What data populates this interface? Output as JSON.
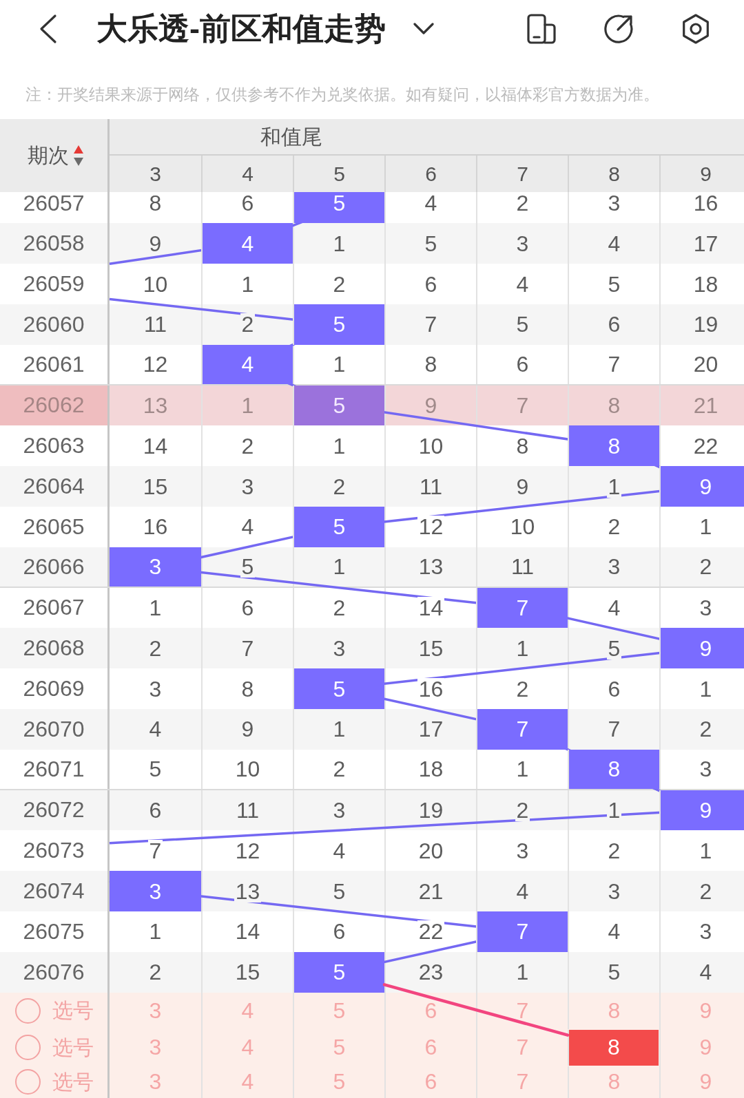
{
  "top_bar": {
    "title": "大乐透-前区和值走势"
  },
  "notice": "注：开奖结果来源于网络，仅供参考不作为兑奖依据。如有疑问，以福体彩官方数据为准。",
  "table": {
    "issue_heading": "期次",
    "sort_ascending": true,
    "group_heading": "和值尾",
    "columns": [
      "3",
      "4",
      "5",
      "6",
      "7",
      "8",
      "9"
    ],
    "rows": [
      {
        "issue": "26057",
        "selected": false,
        "cells": [
          {
            "text": "8",
            "hit": false
          },
          {
            "text": "6",
            "hit": false
          },
          {
            "text": "5",
            "hit": true
          },
          {
            "text": "4",
            "hit": false
          },
          {
            "text": "2",
            "hit": false
          },
          {
            "text": "3",
            "hit": false
          },
          {
            "text": "16",
            "hit": false
          }
        ]
      },
      {
        "issue": "26058",
        "selected": false,
        "cells": [
          {
            "text": "9",
            "hit": false
          },
          {
            "text": "4",
            "hit": true
          },
          {
            "text": "1",
            "hit": false
          },
          {
            "text": "5",
            "hit": false
          },
          {
            "text": "3",
            "hit": false
          },
          {
            "text": "4",
            "hit": false
          },
          {
            "text": "17",
            "hit": false
          }
        ]
      },
      {
        "issue": "26059",
        "selected": false,
        "cells": [
          {
            "text": "10",
            "hit": false
          },
          {
            "text": "1",
            "hit": false
          },
          {
            "text": "2",
            "hit": false
          },
          {
            "text": "6",
            "hit": false
          },
          {
            "text": "4",
            "hit": false
          },
          {
            "text": "5",
            "hit": false
          },
          {
            "text": "18",
            "hit": false
          }
        ]
      },
      {
        "issue": "26060",
        "selected": false,
        "cells": [
          {
            "text": "11",
            "hit": false
          },
          {
            "text": "2",
            "hit": false
          },
          {
            "text": "5",
            "hit": true
          },
          {
            "text": "7",
            "hit": false
          },
          {
            "text": "5",
            "hit": false
          },
          {
            "text": "6",
            "hit": false
          },
          {
            "text": "19",
            "hit": false
          }
        ]
      },
      {
        "issue": "26061",
        "selected": false,
        "cells": [
          {
            "text": "12",
            "hit": false
          },
          {
            "text": "4",
            "hit": true
          },
          {
            "text": "1",
            "hit": false
          },
          {
            "text": "8",
            "hit": false
          },
          {
            "text": "6",
            "hit": false
          },
          {
            "text": "7",
            "hit": false
          },
          {
            "text": "20",
            "hit": false
          }
        ]
      },
      {
        "issue": "26062",
        "selected": true,
        "cells": [
          {
            "text": "13",
            "hit": false
          },
          {
            "text": "1",
            "hit": false
          },
          {
            "text": "5",
            "hit": true
          },
          {
            "text": "9",
            "hit": false
          },
          {
            "text": "7",
            "hit": false
          },
          {
            "text": "8",
            "hit": false
          },
          {
            "text": "21",
            "hit": false
          }
        ]
      },
      {
        "issue": "26063",
        "selected": false,
        "cells": [
          {
            "text": "14",
            "hit": false
          },
          {
            "text": "2",
            "hit": false
          },
          {
            "text": "1",
            "hit": false
          },
          {
            "text": "10",
            "hit": false
          },
          {
            "text": "8",
            "hit": false
          },
          {
            "text": "8",
            "hit": true
          },
          {
            "text": "22",
            "hit": false
          }
        ]
      },
      {
        "issue": "26064",
        "selected": false,
        "cells": [
          {
            "text": "15",
            "hit": false
          },
          {
            "text": "3",
            "hit": false
          },
          {
            "text": "2",
            "hit": false
          },
          {
            "text": "11",
            "hit": false
          },
          {
            "text": "9",
            "hit": false
          },
          {
            "text": "1",
            "hit": false
          },
          {
            "text": "9",
            "hit": true
          }
        ]
      },
      {
        "issue": "26065",
        "selected": false,
        "cells": [
          {
            "text": "16",
            "hit": false
          },
          {
            "text": "4",
            "hit": false
          },
          {
            "text": "5",
            "hit": true
          },
          {
            "text": "12",
            "hit": false
          },
          {
            "text": "10",
            "hit": false
          },
          {
            "text": "2",
            "hit": false
          },
          {
            "text": "1",
            "hit": false
          }
        ]
      },
      {
        "issue": "26066",
        "selected": false,
        "cells": [
          {
            "text": "3",
            "hit": true
          },
          {
            "text": "5",
            "hit": false
          },
          {
            "text": "1",
            "hit": false
          },
          {
            "text": "13",
            "hit": false
          },
          {
            "text": "11",
            "hit": false
          },
          {
            "text": "3",
            "hit": false
          },
          {
            "text": "2",
            "hit": false
          }
        ]
      },
      {
        "issue": "26067",
        "selected": false,
        "cells": [
          {
            "text": "1",
            "hit": false
          },
          {
            "text": "6",
            "hit": false
          },
          {
            "text": "2",
            "hit": false
          },
          {
            "text": "14",
            "hit": false
          },
          {
            "text": "7",
            "hit": true
          },
          {
            "text": "4",
            "hit": false
          },
          {
            "text": "3",
            "hit": false
          }
        ]
      },
      {
        "issue": "26068",
        "selected": false,
        "cells": [
          {
            "text": "2",
            "hit": false
          },
          {
            "text": "7",
            "hit": false
          },
          {
            "text": "3",
            "hit": false
          },
          {
            "text": "15",
            "hit": false
          },
          {
            "text": "1",
            "hit": false
          },
          {
            "text": "5",
            "hit": false
          },
          {
            "text": "9",
            "hit": true
          }
        ]
      },
      {
        "issue": "26069",
        "selected": false,
        "cells": [
          {
            "text": "3",
            "hit": false
          },
          {
            "text": "8",
            "hit": false
          },
          {
            "text": "5",
            "hit": true
          },
          {
            "text": "16",
            "hit": false
          },
          {
            "text": "2",
            "hit": false
          },
          {
            "text": "6",
            "hit": false
          },
          {
            "text": "1",
            "hit": false
          }
        ]
      },
      {
        "issue": "26070",
        "selected": false,
        "cells": [
          {
            "text": "4",
            "hit": false
          },
          {
            "text": "9",
            "hit": false
          },
          {
            "text": "1",
            "hit": false
          },
          {
            "text": "17",
            "hit": false
          },
          {
            "text": "7",
            "hit": true
          },
          {
            "text": "7",
            "hit": false
          },
          {
            "text": "2",
            "hit": false
          }
        ]
      },
      {
        "issue": "26071",
        "selected": false,
        "cells": [
          {
            "text": "5",
            "hit": false
          },
          {
            "text": "10",
            "hit": false
          },
          {
            "text": "2",
            "hit": false
          },
          {
            "text": "18",
            "hit": false
          },
          {
            "text": "1",
            "hit": false
          },
          {
            "text": "8",
            "hit": true
          },
          {
            "text": "3",
            "hit": false
          }
        ]
      },
      {
        "issue": "26072",
        "selected": false,
        "cells": [
          {
            "text": "6",
            "hit": false
          },
          {
            "text": "11",
            "hit": false
          },
          {
            "text": "3",
            "hit": false
          },
          {
            "text": "19",
            "hit": false
          },
          {
            "text": "2",
            "hit": false
          },
          {
            "text": "1",
            "hit": false
          },
          {
            "text": "9",
            "hit": true
          }
        ]
      },
      {
        "issue": "26073",
        "selected": false,
        "cells": [
          {
            "text": "7",
            "hit": false
          },
          {
            "text": "12",
            "hit": false
          },
          {
            "text": "4",
            "hit": false
          },
          {
            "text": "20",
            "hit": false
          },
          {
            "text": "3",
            "hit": false
          },
          {
            "text": "2",
            "hit": false
          },
          {
            "text": "1",
            "hit": false
          }
        ]
      },
      {
        "issue": "26074",
        "selected": false,
        "cells": [
          {
            "text": "3",
            "hit": true
          },
          {
            "text": "13",
            "hit": false
          },
          {
            "text": "5",
            "hit": false
          },
          {
            "text": "21",
            "hit": false
          },
          {
            "text": "4",
            "hit": false
          },
          {
            "text": "3",
            "hit": false
          },
          {
            "text": "2",
            "hit": false
          }
        ]
      },
      {
        "issue": "26075",
        "selected": false,
        "cells": [
          {
            "text": "1",
            "hit": false
          },
          {
            "text": "14",
            "hit": false
          },
          {
            "text": "6",
            "hit": false
          },
          {
            "text": "22",
            "hit": false
          },
          {
            "text": "7",
            "hit": true
          },
          {
            "text": "4",
            "hit": false
          },
          {
            "text": "3",
            "hit": false
          }
        ]
      },
      {
        "issue": "26076",
        "selected": false,
        "cells": [
          {
            "text": "2",
            "hit": false
          },
          {
            "text": "15",
            "hit": false
          },
          {
            "text": "5",
            "hit": true
          },
          {
            "text": "23",
            "hit": false
          },
          {
            "text": "1",
            "hit": false
          },
          {
            "text": "5",
            "hit": false
          },
          {
            "text": "4",
            "hit": false
          }
        ]
      }
    ],
    "pick_rows": [
      {
        "label": "选号",
        "checked": false,
        "cells": [
          {
            "text": "3",
            "selected": false
          },
          {
            "text": "4",
            "selected": false
          },
          {
            "text": "5",
            "selected": false
          },
          {
            "text": "6",
            "selected": false
          },
          {
            "text": "7",
            "selected": false
          },
          {
            "text": "8",
            "selected": false
          },
          {
            "text": "9",
            "selected": false
          }
        ]
      },
      {
        "label": "选号",
        "checked": false,
        "cells": [
          {
            "text": "3",
            "selected": false
          },
          {
            "text": "4",
            "selected": false
          },
          {
            "text": "5",
            "selected": false
          },
          {
            "text": "6",
            "selected": false
          },
          {
            "text": "7",
            "selected": false
          },
          {
            "text": "8",
            "selected": true
          },
          {
            "text": "9",
            "selected": false
          }
        ]
      },
      {
        "label": "选号",
        "checked": false,
        "cells": [
          {
            "text": "3",
            "selected": false
          },
          {
            "text": "4",
            "selected": false
          },
          {
            "text": "5",
            "selected": false
          },
          {
            "text": "6",
            "selected": false
          },
          {
            "text": "7",
            "selected": false
          },
          {
            "text": "8",
            "selected": false
          },
          {
            "text": "9",
            "selected": false
          }
        ]
      }
    ]
  }
}
